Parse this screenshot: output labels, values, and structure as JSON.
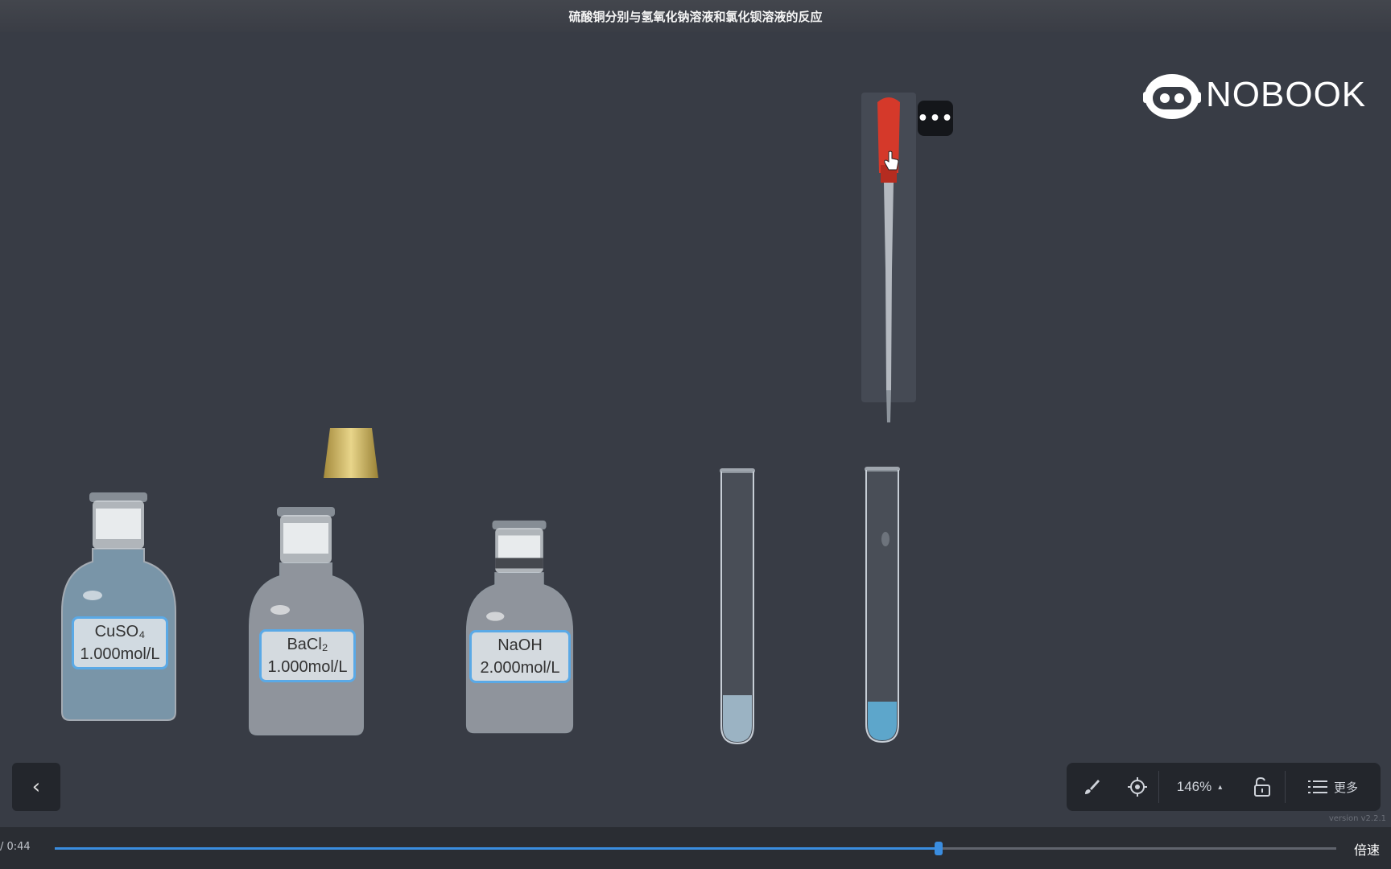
{
  "title": "硫酸铜分别与氢氧化钠溶液和氯化钡溶液的反应",
  "logo": {
    "text": "NOBOOK",
    "icon": "robot-logo-icon"
  },
  "bottles": [
    {
      "formula": "CuSO₄",
      "conc": "1.000mol/L",
      "liquid": "#8fb3c9"
    },
    {
      "formula": "BaCl₂",
      "conc": "1.000mol/L",
      "liquid": "#c9cfd6"
    },
    {
      "formula": "NaOH",
      "conc": "2.000mol/L",
      "liquid": "#c9cfd6"
    }
  ],
  "dropper": {
    "more_label": "•••",
    "bulb_color": "#d5392a"
  },
  "toolbar": {
    "zoom": "146%",
    "zoom_caret": "▴",
    "more_label": "更多",
    "version": "version v2.2.1"
  },
  "player": {
    "time": "/ 0:44",
    "progress": 0.69,
    "speed_label": "倍速"
  },
  "back_label": "‹"
}
